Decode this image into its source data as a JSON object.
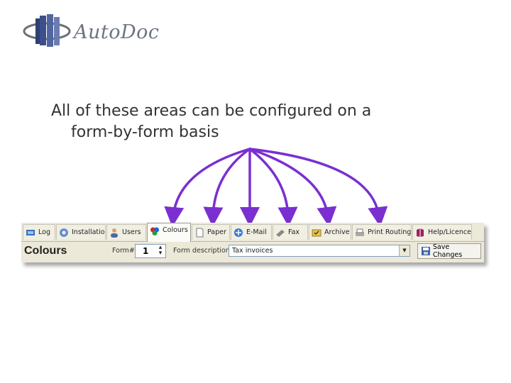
{
  "brand": {
    "name": "AutoDoc"
  },
  "caption": {
    "line1": "All of these areas can be configured on a",
    "line2": "form-by-form basis"
  },
  "tabs": [
    {
      "label": "Log",
      "icon": "log-icon"
    },
    {
      "label": "Installation",
      "icon": "installation-icon"
    },
    {
      "label": "Users",
      "icon": "users-icon"
    },
    {
      "label": "Colours",
      "icon": "colours-icon",
      "active": true
    },
    {
      "label": "Paper",
      "icon": "paper-icon"
    },
    {
      "label": "E-Mail",
      "icon": "email-icon"
    },
    {
      "label": "Fax",
      "icon": "fax-icon"
    },
    {
      "label": "Archive",
      "icon": "archive-icon"
    },
    {
      "label": "Print Routing",
      "icon": "printer-icon"
    },
    {
      "label": "Help/Licence",
      "icon": "help-book-icon"
    }
  ],
  "panel": {
    "title": "Colours",
    "form_label": "Form#",
    "form_number": "1",
    "description_label": "Form description",
    "description_value": "Tax invoices",
    "save_label": "Save Changes"
  },
  "colors": {
    "arrow": "#7a2fd0",
    "tab_bg": "#ece9d8"
  }
}
